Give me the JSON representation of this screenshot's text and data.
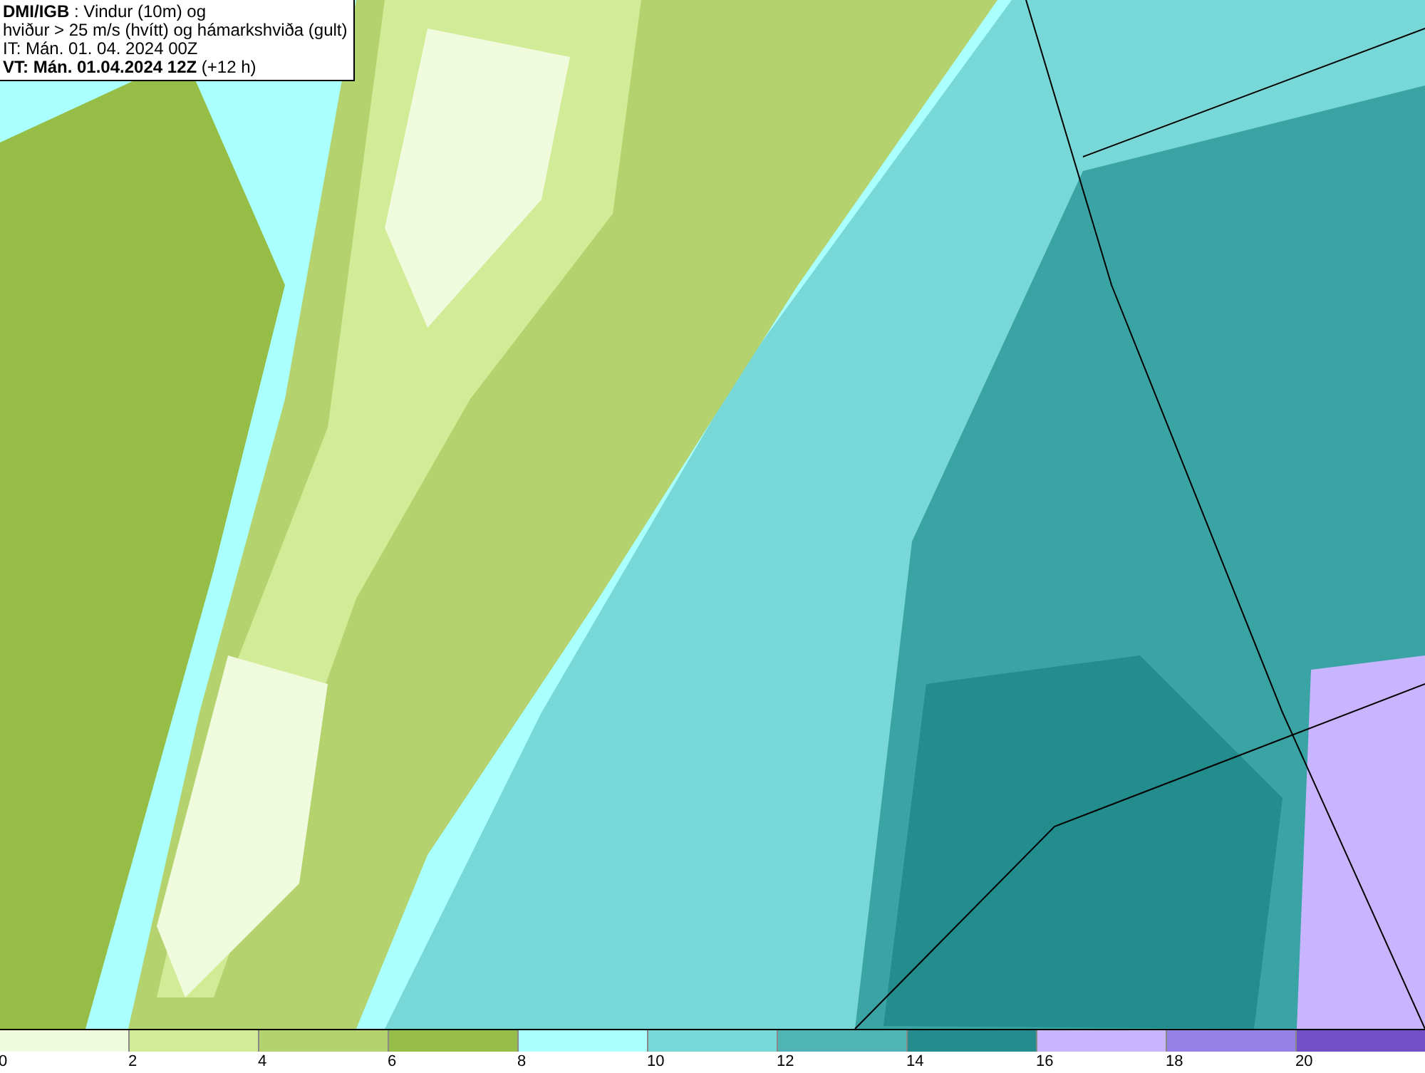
{
  "header": {
    "lines": [
      "**DMI/IGB** : Vindur (10m) og",
      "hviður > 25 m/s (hvítt) og hámarkshviða (gult)",
      "IT: Mán. 01. 04. 2024 00Z",
      "**VT: Mán. 01.04.2024 12Z** (+12 h)"
    ]
  },
  "legend": {
    "segments": [
      {
        "label": "0",
        "color": "#f0fadc"
      },
      {
        "label": "2",
        "color": "#d2eb96"
      },
      {
        "label": "4",
        "color": "#b4d26e"
      },
      {
        "label": "6",
        "color": "#96be46"
      },
      {
        "label": "8",
        "color": "#aaffff"
      },
      {
        "label": "10",
        "color": "#78d7d7"
      },
      {
        "label": "12",
        "color": "#50b4b4"
      },
      {
        "label": "14",
        "color": "#238c8c"
      },
      {
        "label": "16",
        "color": "#c8b4ff"
      },
      {
        "label": "18",
        "color": "#9682e6"
      },
      {
        "label": "20",
        "color": "#7350c8"
      }
    ]
  }
}
